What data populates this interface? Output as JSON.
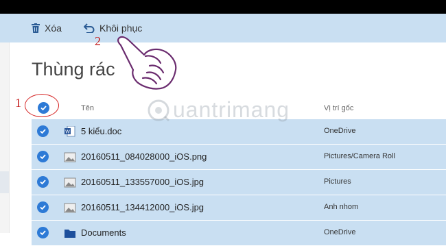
{
  "toolbar": {
    "delete_label": "Xóa",
    "restore_label": "Khôi phục"
  },
  "page": {
    "title": "Thùng rác"
  },
  "table": {
    "columns": {
      "name": "Tên",
      "location": "Vị trí gốc"
    },
    "rows": [
      {
        "name": "5 kiểu.doc",
        "location": "OneDrive",
        "icon": "word-doc-icon",
        "selected": true
      },
      {
        "name": "20160511_084028000_iOS.png",
        "location": "Pictures/Camera Roll",
        "icon": "image-icon",
        "selected": true
      },
      {
        "name": "20160511_133557000_iOS.jpg",
        "location": "Pictures",
        "icon": "image-icon",
        "selected": true
      },
      {
        "name": "20160511_134412000_iOS.jpg",
        "location": "Anh nhom",
        "icon": "image-icon",
        "selected": true
      },
      {
        "name": "Documents",
        "location": "OneDrive",
        "icon": "folder-icon",
        "selected": true
      }
    ]
  },
  "annotations": {
    "step1": "1",
    "step2": "2"
  },
  "watermark": {
    "text": "uantrimang"
  },
  "colors": {
    "accent": "#2d7ad6",
    "selection": "#c9dff2",
    "annotation": "#d52222"
  }
}
